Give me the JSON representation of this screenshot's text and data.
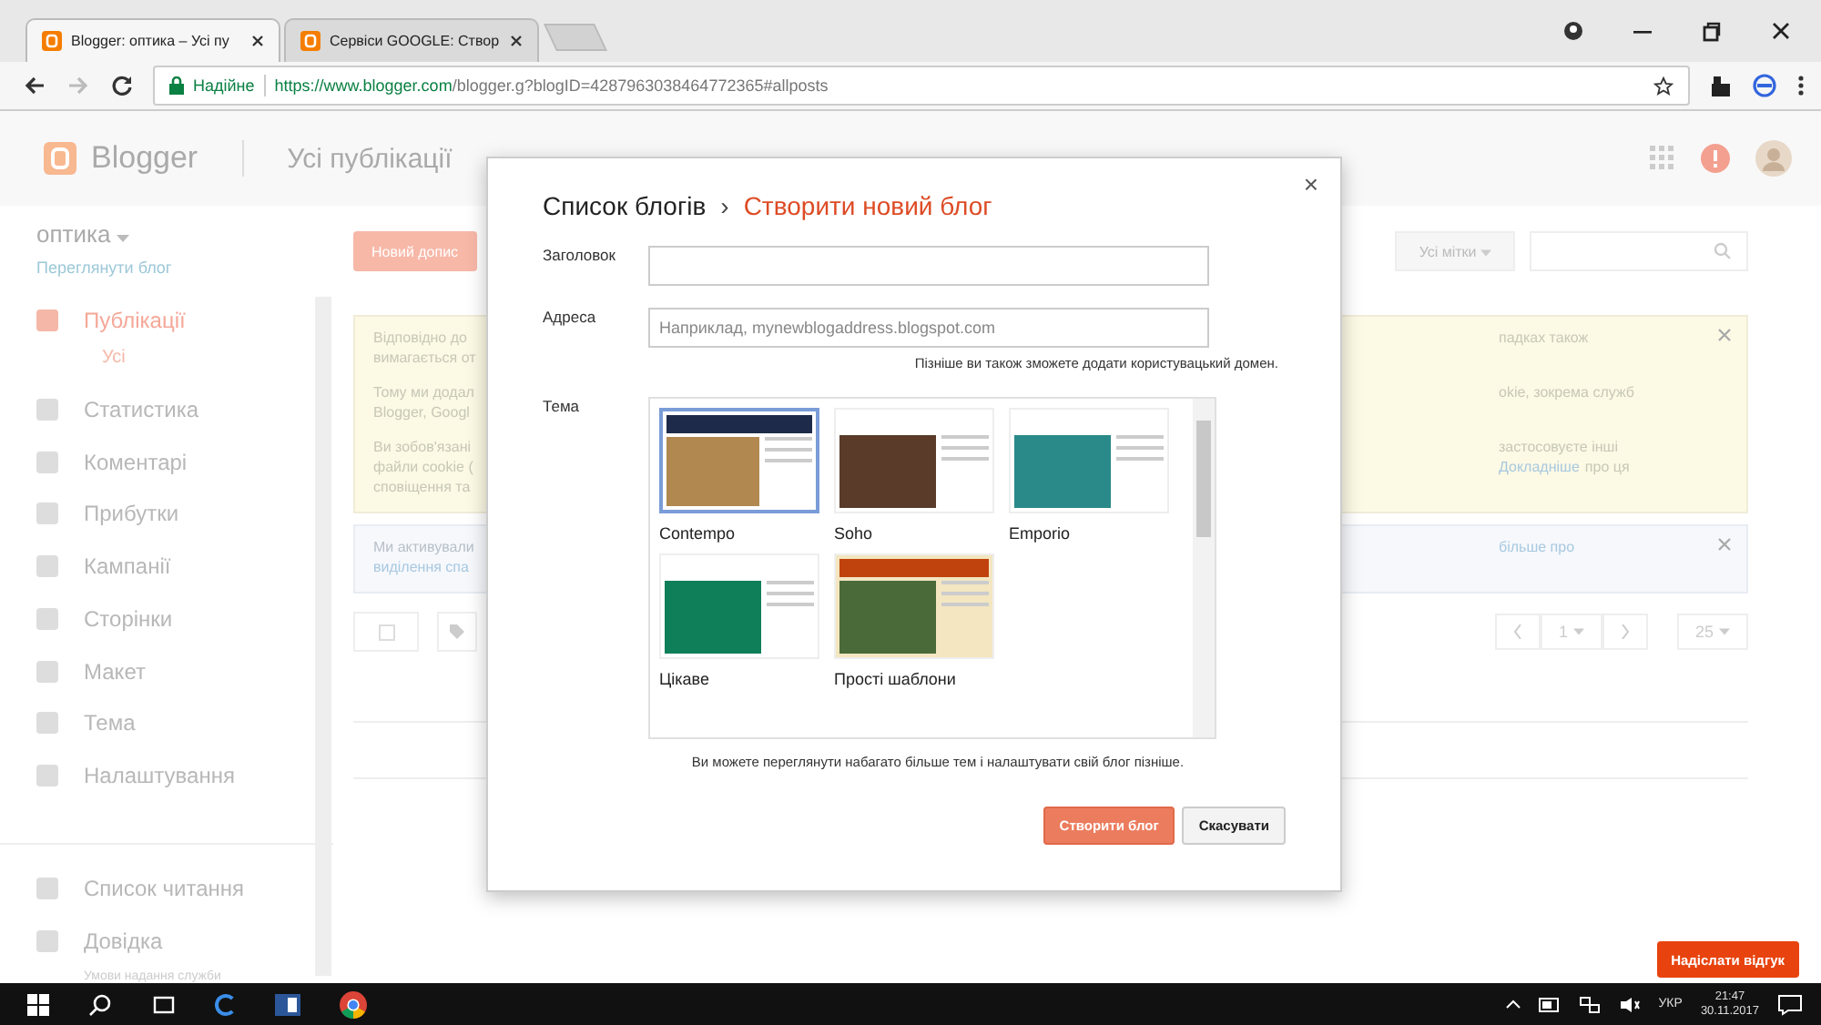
{
  "browser": {
    "tabs": [
      {
        "title": "Blogger: оптика – Усі пу",
        "selected": true
      },
      {
        "title": "Сервіси GOOGLE: Створ",
        "selected": false
      }
    ],
    "security_label": "Надійне",
    "url_host": "https://www.blogger.com",
    "url_path": "/blogger.g?blogID=4287963038464772365#allposts"
  },
  "header": {
    "app_name": "Blogger",
    "page_title": "Усі публікації"
  },
  "sidebar": {
    "blog_name": "оптика",
    "view_blog_link": "Переглянути блог",
    "items": [
      {
        "label": "Публікації",
        "selected": true,
        "children": [
          {
            "label": "Усі",
            "selected": true
          }
        ]
      },
      {
        "label": "Статистика",
        "selected": false
      },
      {
        "label": "Коментарі",
        "selected": false
      },
      {
        "label": "Прибутки",
        "selected": false
      },
      {
        "label": "Кампанії",
        "selected": false
      },
      {
        "label": "Сторінки",
        "selected": false
      },
      {
        "label": "Макет",
        "selected": false
      },
      {
        "label": "Тема",
        "selected": false
      },
      {
        "label": "Налаштування",
        "selected": false
      }
    ],
    "secondary_items": [
      {
        "label": "Список читання",
        "selected": false
      },
      {
        "label": "Довідка",
        "selected": false
      }
    ],
    "footer_text": "Умови надання служби"
  },
  "content": {
    "new_post_button": "Новий допис",
    "labels_dropdown": "Усі мітки",
    "notices": [
      {
        "kind": "warning",
        "paragraphs": [
          {
            "left": [
              {
                "text": "Відповідно до",
                "link": false
              },
              {
                "text": "вимагається от",
                "link": false
              }
            ],
            "right": [
              {
                "text": "падках також",
                "link": false
              }
            ]
          },
          {
            "left": [
              {
                "text": "Тому ми додал",
                "link": false
              },
              {
                "text": "Blogger, Googl",
                "link": false
              }
            ],
            "right": [
              {
                "text": "okie, зокрема служб",
                "link": false
              }
            ]
          },
          {
            "left": [
              {
                "text": "Ви зобов'язані",
                "link": false
              },
              {
                "text": "файли cookie (",
                "link": false
              },
              {
                "text": "сповіщення та",
                "link": false
              }
            ],
            "right": [
              {
                "text": "застосовуєте інші",
                "link": false
              },
              {
                "text": "Докладніше",
                "link": true
              },
              {
                "text": "про ця",
                "link": false
              }
            ]
          }
        ]
      },
      {
        "kind": "info",
        "paragraphs": [
          {
            "left": [
              {
                "text": "Ми активували",
                "link": false
              },
              {
                "text": "виділення спа",
                "link": true
              }
            ],
            "right": [
              {
                "text": "більше про",
                "link": true
              }
            ]
          }
        ]
      }
    ],
    "pagination": {
      "page": "1",
      "per_page": "25"
    }
  },
  "dialog": {
    "breadcrumb_parent": "Список блогів",
    "breadcrumb_separator": "›",
    "title": "Створити новий блог",
    "title_label": "Заголовок",
    "address_label": "Адреса",
    "address_placeholder": "Наприклад, mynewblogaddress.blogspot.com",
    "domain_hint": "Пізніше ви також зможете додати користувацький домен.",
    "theme_label": "Тема",
    "themes": [
      {
        "name": "Contempo",
        "selected": true
      },
      {
        "name": "Soho",
        "selected": false
      },
      {
        "name": "Emporio",
        "selected": false
      },
      {
        "name": "Цікаве",
        "selected": false
      },
      {
        "name": "Прості шаблони",
        "selected": false
      }
    ],
    "themes_note": "Ви можете переглянути набагато більше тем і налаштувати свій блог пізніше.",
    "create_button": "Створити блог",
    "cancel_button": "Скасувати",
    "close": "×"
  },
  "feedback_button": "Надіслати відгук",
  "taskbar": {
    "language": "УКР",
    "time": "21:47",
    "date": "30.11.2017"
  }
}
